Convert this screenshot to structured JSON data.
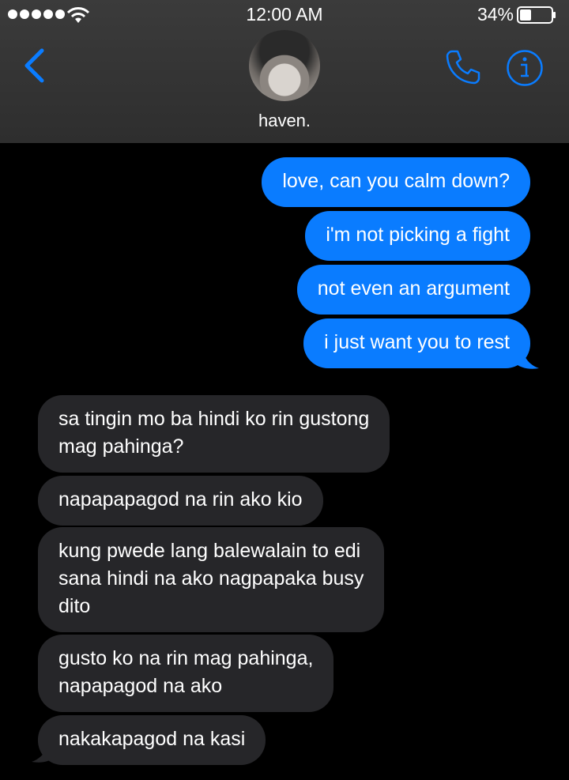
{
  "status_bar": {
    "time": "12:00 AM",
    "battery_percent": "34%",
    "signal_icon": "signal-dots-icon",
    "wifi_icon": "wifi-icon",
    "battery_icon": "battery-icon"
  },
  "header": {
    "contact_name": "haven.",
    "back_icon": "chevron-left-icon",
    "phone_icon": "phone-icon",
    "info_icon": "info-icon",
    "accent_color": "#0a7cff"
  },
  "messages": {
    "sent": [
      "love, can you calm down?",
      "i'm not picking a fight",
      "not even an argument",
      "i just want you to rest"
    ],
    "received": [
      "sa tingin mo ba hindi ko rin gustong\nmag pahinga?",
      "napapapagod na rin ako kio",
      "kung pwede lang balewalain to edi\nsana hindi na ako nagpapaka busy\ndito",
      "gusto ko na rin mag pahinga,\nnapapagod na ako",
      "nakakapagod na kasi"
    ],
    "sent_color": "#0a7cff",
    "received_color": "#262629"
  }
}
